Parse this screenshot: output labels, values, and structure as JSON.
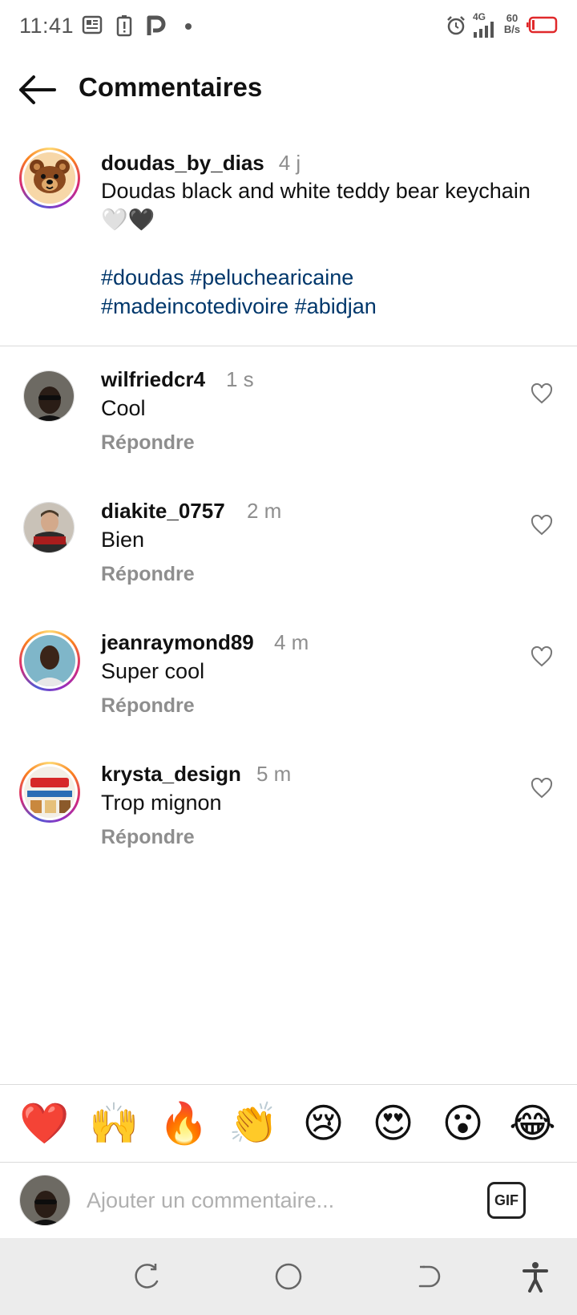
{
  "status_bar": {
    "time": "11:41",
    "network_type": "4G",
    "data_rate_value": "60",
    "data_rate_unit": "B/s",
    "icons": [
      "news-icon",
      "battery-alert-icon",
      "p-icon",
      "dot-icon",
      "alarm-icon",
      "signal-icon",
      "battery-icon"
    ]
  },
  "header": {
    "title": "Commentaires"
  },
  "caption": {
    "username": "doudas_by_dias",
    "time": "4 j",
    "text": "Doudas black and white teddy bear keychain 🤍🖤",
    "hashtags": [
      "#doudas",
      "#peluchearicaine",
      "#madeincotedivoire",
      "#abidjan"
    ]
  },
  "comments": [
    {
      "username": "wilfriedcr4",
      "time": "1 s",
      "text": "Cool",
      "reply": "Répondre",
      "ring": false
    },
    {
      "username": "diakite_0757",
      "time": "2 m",
      "text": "Bien",
      "reply": "Répondre",
      "ring": false
    },
    {
      "username": "jeanraymond89",
      "time": "4 m",
      "text": "Super cool",
      "reply": "Répondre",
      "ring": true
    },
    {
      "username": "krysta_design",
      "time": "5 m",
      "text": "Trop mignon",
      "reply": "Répondre",
      "ring": true
    }
  ],
  "emoji_bar": [
    "❤️",
    "🙌",
    "🔥",
    "👏",
    "😢",
    "😍",
    "😮",
    "😂"
  ],
  "composer": {
    "placeholder": "Ajouter un commentaire...",
    "gif_label": "GIF"
  },
  "colors": {
    "hashtag": "#00376b",
    "muted": "#8e8e8e",
    "battery_low": "#e0292b"
  }
}
